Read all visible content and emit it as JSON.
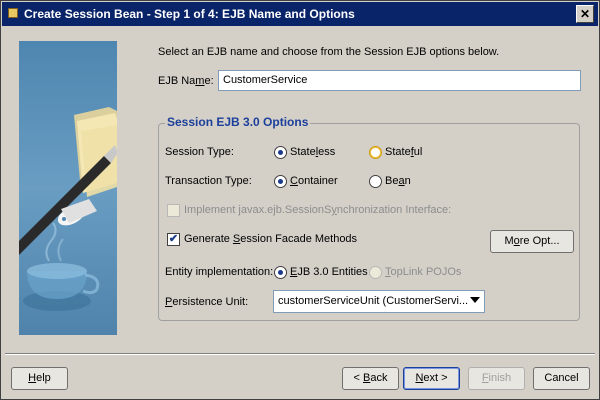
{
  "window": {
    "title": "Create Session Bean - Step 1 of 4: EJB Name and Options",
    "close_label": "✕"
  },
  "intro": "Select an EJB name and choose from the Session EJB options below.",
  "ejb_name": {
    "label_pre": "EJB Na",
    "label_mn": "m",
    "label_post": "e:",
    "value": "CustomerService"
  },
  "group": {
    "title": "Session EJB 3.0 Options"
  },
  "session_type": {
    "label": "Session Type:",
    "stateless": {
      "pre": "State",
      "mn": "l",
      "post": "ess",
      "selected": true
    },
    "stateful": {
      "pre": "State",
      "mn": "f",
      "post": "ul",
      "selected": false
    }
  },
  "transaction_type": {
    "label": "Transaction Type:",
    "container": {
      "pre": "",
      "mn": "C",
      "post": "ontainer",
      "selected": true
    },
    "bean": {
      "pre": "Be",
      "mn": "a",
      "post": "n",
      "selected": false
    }
  },
  "session_sync": {
    "pre": "Implement javax.ejb.SessionS",
    "mn": "y",
    "post": "nchronization Interface:",
    "checked": false,
    "enabled": false
  },
  "facade": {
    "pre": "Generate ",
    "mn": "S",
    "post": "ession Facade Methods",
    "checked": true,
    "check_glyph": "✔"
  },
  "more_options": {
    "pre": "M",
    "mn": "o",
    "post": "re Opt..."
  },
  "entity_impl": {
    "label": "Entity implementation:",
    "ejb30": {
      "pre": "",
      "mn": "E",
      "post": "JB 3.0 Entities",
      "selected": true
    },
    "toplink": {
      "pre": "",
      "mn": "T",
      "post": "opLink POJOs",
      "selected": false,
      "enabled": false
    }
  },
  "persistence_unit": {
    "pre": "",
    "mn": "P",
    "post": "ersistence Unit:",
    "value": "customerServiceUnit (CustomerServi..."
  },
  "buttons": {
    "help": {
      "pre": "",
      "mn": "H",
      "post": "elp"
    },
    "back": {
      "pre": "< ",
      "mn": "B",
      "post": "ack"
    },
    "next": {
      "pre": "",
      "mn": "N",
      "post": "ext >"
    },
    "finish": {
      "pre": "",
      "mn": "F",
      "post": "inish",
      "enabled": false
    },
    "cancel": {
      "label": "Cancel"
    }
  },
  "colors": {
    "title_bar": "#0a246a",
    "group_title": "#1c3f9b",
    "sidebar": "#5a8fb5"
  },
  "icons": [
    "wizard-illustration",
    "close-icon"
  ]
}
